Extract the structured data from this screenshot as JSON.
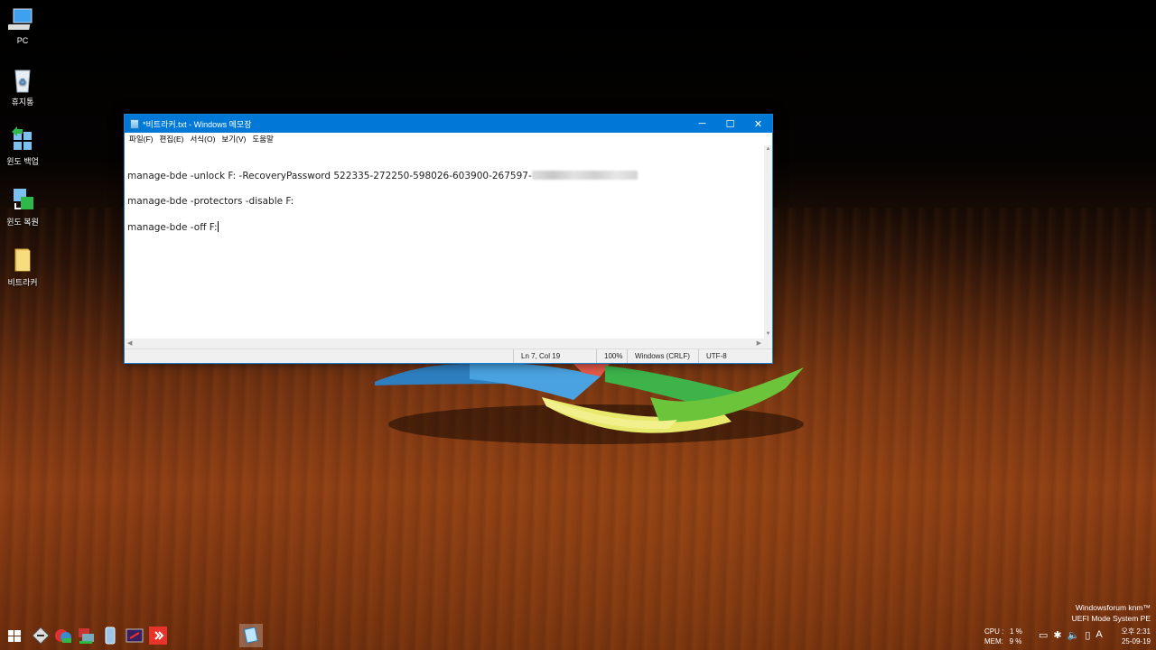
{
  "desktop": {
    "icons": [
      {
        "label": "PC",
        "icon": "monitor-icon"
      },
      {
        "label": "휴지통",
        "icon": "recycle-bin-icon"
      },
      {
        "label": "윈도 백업",
        "icon": "backup-icon"
      },
      {
        "label": "윈도 복원",
        "icon": "restore-icon"
      },
      {
        "label": "비트라커",
        "icon": "folder-icon"
      }
    ],
    "watermark_line1": "Windowsforum knm™",
    "watermark_line2": "UEFI Mode System PE"
  },
  "notepad": {
    "title": "*비트라커.txt - Windows 메모장",
    "menu": [
      "파일(F)",
      "편집(E)",
      "서식(O)",
      "보기(V)",
      "도움말"
    ],
    "lines": {
      "line1": "manage-bde -unlock F: -RecoveryPassword 522335-272250-598026-603900-267597-",
      "line2": "manage-bde -protectors -disable F:",
      "line3": "manage-bde -off F:"
    },
    "status": {
      "position": "Ln 7, Col 19",
      "zoom": "100%",
      "line_ending": "Windows (CRLF)",
      "encoding": "UTF-8"
    },
    "controls": {
      "minimize": "─",
      "maximize": "☐",
      "close": "✕"
    }
  },
  "tray": {
    "cpu_label": "CPU :",
    "cpu_value": "1 %",
    "mem_label": "MEM:",
    "mem_value": "9 %",
    "ime": "A",
    "time": "오후 2:31",
    "date": "25-09-19"
  },
  "colors": {
    "titlebar": "#0078d7",
    "accent": "#1883d7"
  }
}
